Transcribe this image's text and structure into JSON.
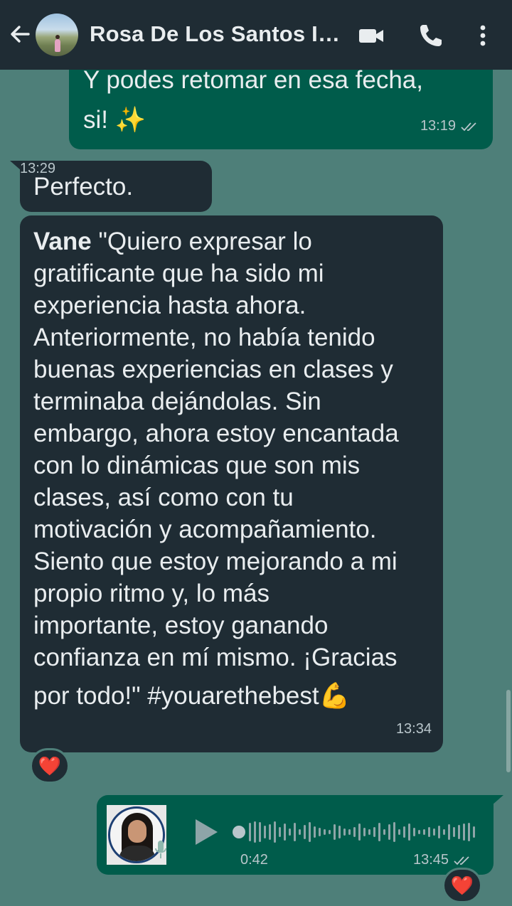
{
  "header": {
    "contact_name": "Rosa De Los Santos In...",
    "icons": [
      "back-arrow-icon",
      "video-call-icon",
      "phone-icon",
      "more-options-icon"
    ]
  },
  "messages": [
    {
      "direction": "outgoing",
      "lines": [
        "Y podes retomar en esa fecha,",
        "si! ✨"
      ],
      "time": "13:19",
      "status": "read"
    },
    {
      "direction": "incoming",
      "text": "Perfecto.",
      "time": "13:29"
    },
    {
      "direction": "incoming",
      "sender": "Vane",
      "lines": [
        "\"Quiero expresar lo",
        "gratificante que ha sido mi",
        "experiencia hasta ahora.",
        "Anteriormente, no había tenido",
        "buenas experiencias en clases y",
        "terminaba dejándolas. Sin",
        "embargo, ahora estoy encantada",
        "con lo dinámicas que son mis",
        "clases, así como con tu",
        "motivación y acompañamiento.",
        "Siento que estoy mejorando a mi",
        "propio ritmo y, lo más",
        "importante, estoy ganando",
        "confianza en mí mismo. ¡Gracias",
        "por todo!\" #youarethebest💪"
      ],
      "time": "13:34",
      "reaction": "❤️"
    },
    {
      "direction": "outgoing",
      "type": "voice",
      "duration": "0:42",
      "time": "13:45",
      "status": "read",
      "reaction": "❤️"
    }
  ],
  "colors": {
    "background": "#4e7f79",
    "header": "#1f2c34",
    "outgoing_bubble": "#005c4b",
    "incoming_bubble": "#1f2c34"
  }
}
